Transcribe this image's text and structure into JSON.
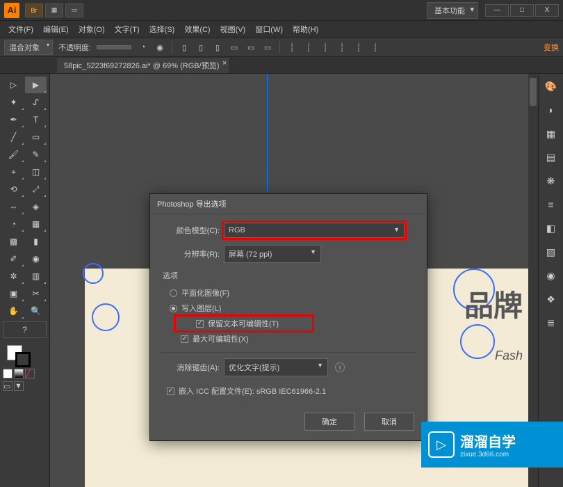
{
  "titlebar": {
    "logo": "Ai",
    "workspace_label": "基本功能",
    "btn_min": "—",
    "btn_max": "□",
    "btn_close": "X"
  },
  "menubar": {
    "items": [
      "文件(F)",
      "编辑(E)",
      "对象(O)",
      "文字(T)",
      "选择(S)",
      "效果(C)",
      "视图(V)",
      "窗口(W)",
      "帮助(H)"
    ]
  },
  "optbar": {
    "style_label": "混合对象",
    "opacity_label": "不透明度:",
    "transform_link": "变换"
  },
  "doctab": {
    "label": "58pic_5223f69272826.ai* @ 69% (RGB/预览)"
  },
  "artboard": {
    "title_cn": "品牌",
    "subtitle_en": "Fash"
  },
  "dialog": {
    "title": "Photoshop 导出选项",
    "color_model_label": "颜色模型(C):",
    "color_model_value": "RGB",
    "resolution_label": "分辨率(R):",
    "resolution_value": "屏幕 (72 ppi)",
    "options_group": "选项",
    "flat_image_label": "平面化图像(F)",
    "write_layers_label": "写入图层(L)",
    "preserve_text_label": "保留文本可编辑性(T)",
    "max_edit_label": "最大可编辑性(X)",
    "antialias_label": "消除锯齿(A):",
    "antialias_value": "优化文字(提示)",
    "embed_icc_label": "嵌入 ICC 配置文件(E): sRGB IEC61966-2.1",
    "ok_label": "确定",
    "cancel_label": "取消"
  },
  "watermark": {
    "cn": "溜溜自学",
    "en": "zixue.3d66.com"
  },
  "icons": {
    "br": "Br",
    "grid": "▦",
    "arrange": "▭"
  }
}
